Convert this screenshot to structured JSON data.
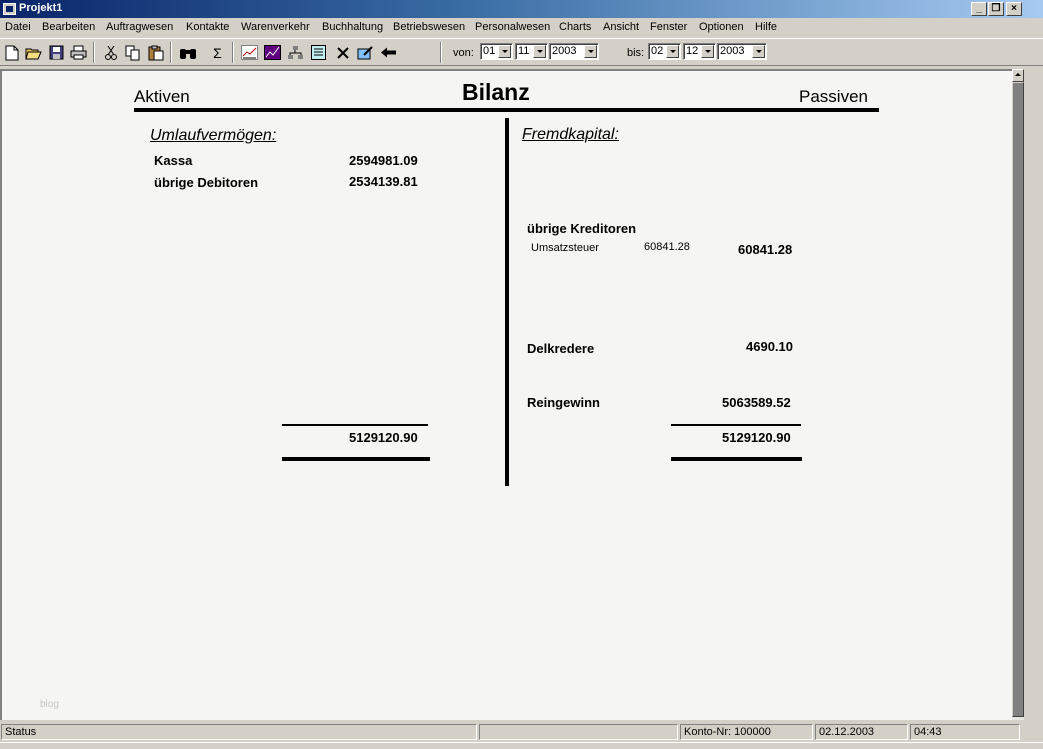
{
  "window": {
    "title": "Projekt1",
    "controls": {
      "minimize": "_",
      "restore": "❐",
      "close": "×"
    }
  },
  "menu": [
    "Datei",
    "Bearbeiten",
    "Auftragwesen",
    "Kontakte",
    "Warenverkehr",
    "Buchhaltung",
    "Betriebswesen",
    "Personalwesen",
    "Charts",
    "Ansicht",
    "Fenster",
    "Optionen",
    "Hilfe"
  ],
  "toolbar": {
    "tools": [
      "new-icon",
      "open-folder-icon",
      "save-icon",
      "print-icon",
      "cut-icon",
      "copy-icon",
      "paste-icon",
      "binoculars-icon",
      "sum-icon",
      "chart-icon",
      "line-chart-icon",
      "hierarchy-icon",
      "list-icon",
      "delete-icon",
      "edit-icon",
      "back-arrow-icon"
    ],
    "sum_glyph": "Σ",
    "von_label": "von:",
    "von_day": "01",
    "von_month": "11",
    "von_year": "2003",
    "bis_label": "bis:",
    "bis_day": "02",
    "bis_month": "12",
    "bis_year": "2003"
  },
  "bilanz": {
    "title": "Bilanz",
    "left_header": "Aktiven",
    "right_header": "Passiven",
    "aktiven": {
      "section": "Umlaufvermögen:",
      "rows": [
        {
          "label": "Kassa",
          "value": "2594981.09"
        },
        {
          "label": "übrige Debitoren",
          "value": "2534139.81"
        }
      ],
      "total": "5129120.90"
    },
    "passiven": {
      "section": "Fremdkapital:",
      "kreditoren_label": "übrige Kreditoren",
      "sub_label": "Umsatzsteuer",
      "sub_value": "60841.28",
      "kreditoren_value": "60841.28",
      "delkredere_label": "Delkredere",
      "delkredere_value": "4690.10",
      "reingewinn_label": "Reingewinn",
      "reingewinn_value": "5063589.52",
      "total": "5129120.90"
    },
    "watermark": "blog"
  },
  "status": {
    "text": "Status",
    "konto": "Konto-Nr: 100000",
    "date": "02.12.2003",
    "time": "04:43"
  }
}
